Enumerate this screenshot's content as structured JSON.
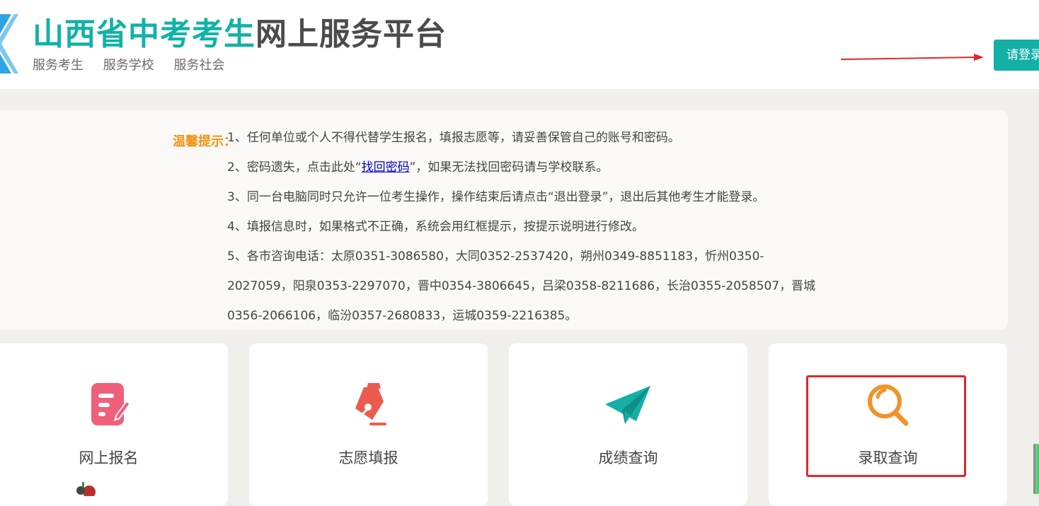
{
  "header": {
    "title_part1": "山西省中考考生",
    "title_part2": "网上服务平台",
    "slogans": [
      "服务考生",
      "服务学校",
      "服务社会"
    ],
    "login_label": "请登录"
  },
  "notice": {
    "label": "温馨提示：",
    "items": [
      "1、任何单位或个人不得代替学生报名，填报志愿等，请妥善保管自己的账号和密码。",
      "3、同一台电脑同时只允许一位考生操作，操作结束后请点击“退出登录”，退出后其他考生才能登录。",
      "4、填报信息时，如果格式不正确，系统会用红框提示，按提示说明进行修改。"
    ],
    "item2_prefix": "2、密码遗失，点击此处“",
    "item2_link": "找回密码",
    "item2_suffix": "”，如果无法找回密码请与学校联系。",
    "item5_lines": [
      "5、各市咨询电话：太原0351-3086580，大同0352-2537420，朔州0349-8851183，忻州0350-",
      "2027059，阳泉0353-2297070，晋中0354-3806645，吕梁0358-8211686，长治0355-2058507，晋城",
      "0356-2066106，临汾0357-2680833，运城0359-2216385。"
    ]
  },
  "cards": [
    {
      "label": "网上报名",
      "icon": "edit-form-icon",
      "color": "#f0607a"
    },
    {
      "label": "志愿填报",
      "icon": "fountain-pen-icon",
      "color": "#ec5a4e"
    },
    {
      "label": "成绩查询",
      "icon": "paper-plane-icon",
      "color": "#14b0a6"
    },
    {
      "label": "录取查询",
      "icon": "magnifier-icon",
      "color": "#f39226"
    }
  ],
  "colors": {
    "brand": "#10b2a7",
    "accent_orange": "#f39214",
    "highlight_red": "#e1282b"
  }
}
